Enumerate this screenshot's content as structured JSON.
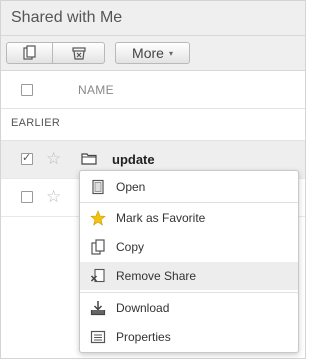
{
  "header": {
    "title": "Shared with Me"
  },
  "toolbar": {
    "copy_icon": "copy-icon",
    "remove_icon": "remove-share-icon",
    "more_label": "More",
    "more_caret": "▾"
  },
  "list": {
    "column_name": "NAME",
    "section": "EARLIER",
    "rows": [
      {
        "name": "update",
        "checked": true,
        "starred": false,
        "icon": "folder-icon"
      },
      {
        "name": "",
        "checked": false,
        "starred": false,
        "icon": ""
      }
    ]
  },
  "context_menu": {
    "items": [
      {
        "label": "Open",
        "icon": "open-icon"
      },
      {
        "label": "Mark as Favorite",
        "icon": "star-icon"
      },
      {
        "label": "Copy",
        "icon": "copy-icon"
      },
      {
        "label": "Remove Share",
        "icon": "remove-share-icon",
        "highlighted": true
      },
      {
        "label": "Download",
        "icon": "download-icon"
      },
      {
        "label": "Properties",
        "icon": "properties-icon"
      }
    ]
  },
  "colors": {
    "star_yellow": "#f3c20c",
    "menu_hover": "#ededed",
    "header_bg": "#efefef"
  }
}
